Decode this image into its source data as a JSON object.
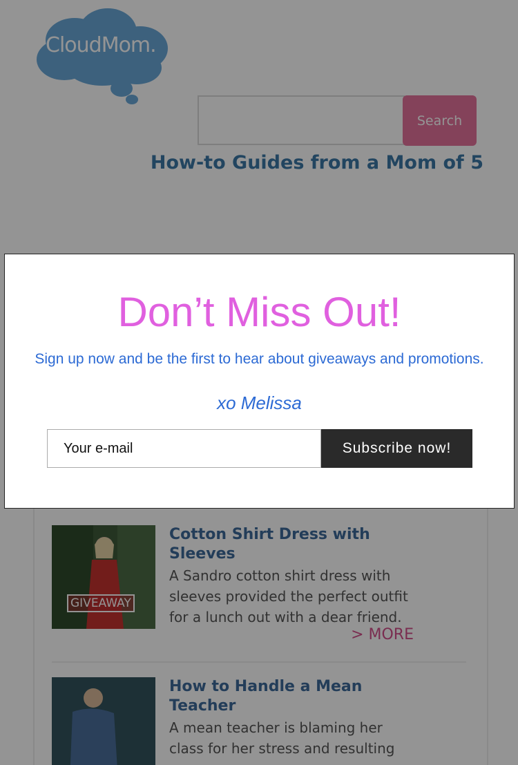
{
  "header": {
    "logo_text": "CloudMom.",
    "logo_mark": "®",
    "search_button": "Search",
    "search_placeholder": "",
    "tagline": "How-to Guides from a Mom of 5"
  },
  "articles": [
    {
      "title": "Cotton Shirt Dress with Sleeves",
      "body": "A Sandro cotton shirt dress with sleeves provided the perfect outfit for a lunch out with a dear friend.",
      "more": "> MORE",
      "thumb_tag": "GIVEAWAY"
    },
    {
      "title": "How to Handle a Mean Teacher",
      "body": "A mean teacher is blaming her class for her stress and resulting"
    }
  ],
  "modal": {
    "title": "Don’t Miss Out!",
    "subtitle": "Sign up now and be the first to hear about giveaways and promotions.",
    "signature": "xo Melissa",
    "email_placeholder": "Your e-mail",
    "subscribe_label": "Subscribe now!"
  },
  "colors": {
    "brand_pink": "#e3739c",
    "title_magenta": "#e060df",
    "link_blue": "#2c6ad4",
    "logo_blue": "#6aa8d8"
  },
  "icons": [
    "cloud-logo-icon"
  ]
}
